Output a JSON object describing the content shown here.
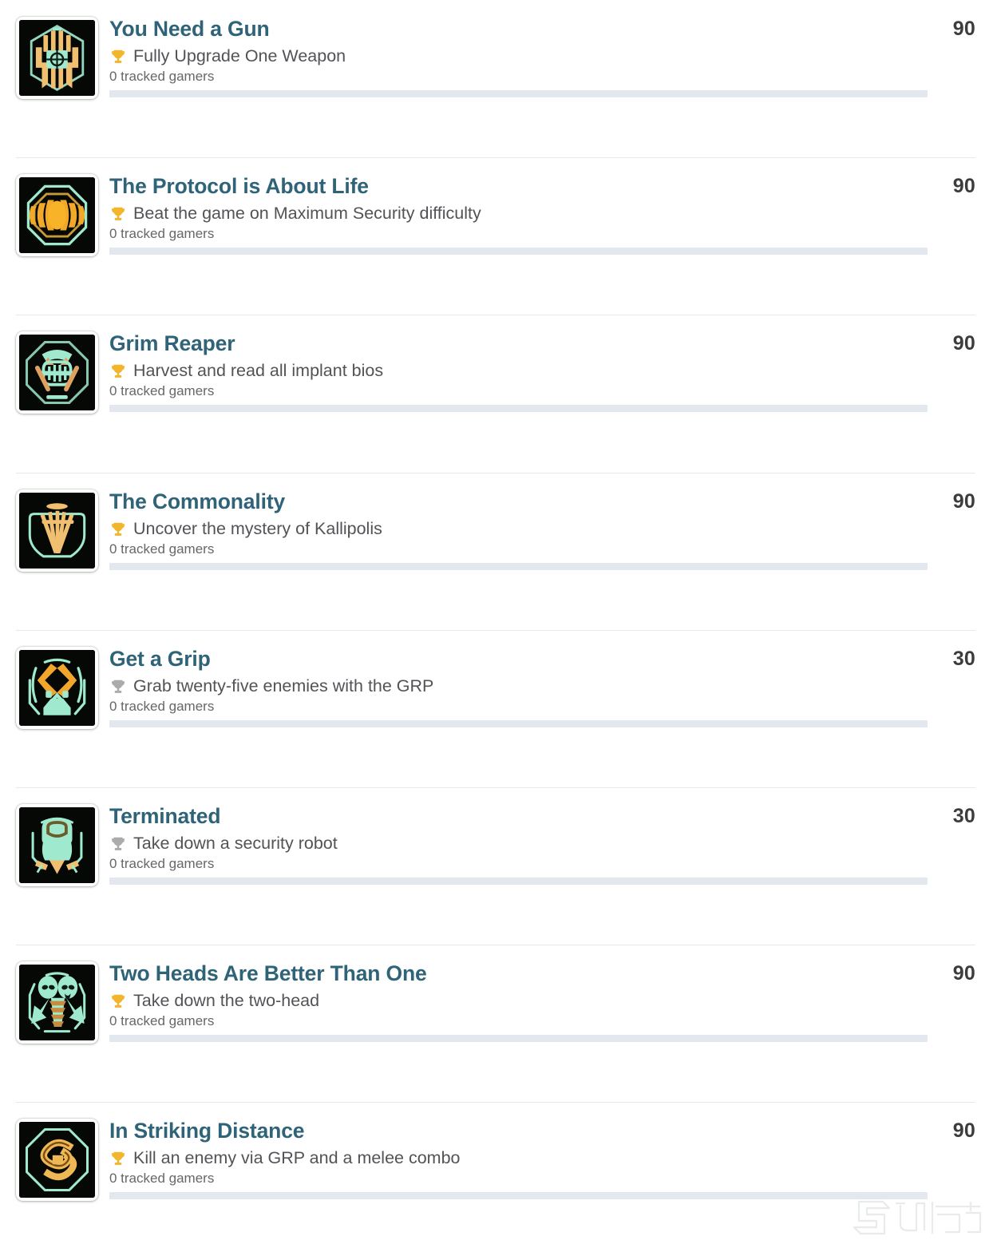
{
  "list": {
    "tracked_suffix": "tracked gamers",
    "achievements": [
      {
        "title": "You Need a Gun",
        "description": "Fully Upgrade One Weapon",
        "tracked": "0 tracked gamers",
        "score": "90",
        "trophy": "gold-trophy-icon",
        "icon": "achievement-icon-you-need-a-gun",
        "progress": "0"
      },
      {
        "title": "The Protocol is About Life",
        "description": "Beat the game on Maximum Security difficulty",
        "tracked": "0 tracked gamers",
        "score": "90",
        "trophy": "gold-trophy-icon",
        "icon": "achievement-icon-the-protocol-is-about-life",
        "progress": "0"
      },
      {
        "title": "Grim Reaper",
        "description": "Harvest and read all implant bios",
        "tracked": "0 tracked gamers",
        "score": "90",
        "trophy": "gold-trophy-icon",
        "icon": "achievement-icon-grim-reaper",
        "progress": "0"
      },
      {
        "title": "The Commonality",
        "description": "Uncover the mystery of Kallipolis",
        "tracked": "0 tracked gamers",
        "score": "90",
        "trophy": "gold-trophy-icon",
        "icon": "achievement-icon-the-commonality",
        "progress": "0"
      },
      {
        "title": "Get a Grip",
        "description": "Grab twenty-five enemies with the GRP",
        "tracked": "0 tracked gamers",
        "score": "30",
        "trophy": "silver-trophy-icon",
        "icon": "achievement-icon-get-a-grip",
        "progress": "0"
      },
      {
        "title": "Terminated",
        "description": "Take down a security robot",
        "tracked": "0 tracked gamers",
        "score": "30",
        "trophy": "silver-trophy-icon",
        "icon": "achievement-icon-terminated",
        "progress": "0"
      },
      {
        "title": "Two Heads Are Better Than One",
        "description": "Take down the two-head",
        "tracked": "0 tracked gamers",
        "score": "90",
        "trophy": "gold-trophy-icon",
        "icon": "achievement-icon-two-heads-are-better-than-one",
        "progress": "0"
      },
      {
        "title": "In Striking Distance",
        "description": "Kill an enemy via GRP and a melee combo",
        "tracked": "0 tracked gamers",
        "score": "90",
        "trophy": "gold-trophy-icon",
        "icon": "achievement-icon-in-striking-distance",
        "progress": "0"
      }
    ]
  },
  "watermark": {
    "text": "九游",
    "name": "jiuyou-watermark"
  },
  "colors": {
    "title_link": "#2f6378",
    "description": "#525356",
    "tracked": "#676767",
    "score": "#3c3c3c",
    "progress_track": "#e3e8ee",
    "separator": "#e6e8ea",
    "gold_trophy": "#f0b429",
    "silver_trophy": "#a9a9a9",
    "icon_bg": "#060a06",
    "icon_teal": "#8fe8c8",
    "icon_gold": "#f0c070"
  }
}
